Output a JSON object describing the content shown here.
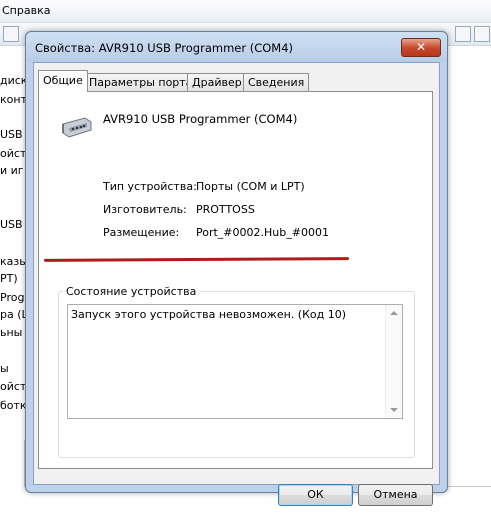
{
  "background_window": {
    "menu": {
      "help_label": "Справка"
    },
    "tree_fragments": [
      "диско",
      "контр",
      "USB",
      "ойств",
      "и иг",
      "USB",
      "казы",
      "PT)",
      "Prog",
      "ра (L",
      "ьны",
      "ы",
      "ойст",
      "ботк"
    ]
  },
  "dialog": {
    "title": "Свойства: AVR910 USB Programmer (COM4)",
    "close_glyph": "✕",
    "tabs": [
      {
        "label": "Общие",
        "active": true
      },
      {
        "label": "Параметры порта",
        "active": false
      },
      {
        "label": "Драйвер",
        "active": false
      },
      {
        "label": "Сведения",
        "active": false
      }
    ],
    "device_name": "AVR910 USB Programmer (COM4)",
    "properties": [
      {
        "label": "Тип устройства:",
        "value": "Порты (COM и LPT)"
      },
      {
        "label": "Изготовитель:",
        "value": "PROTTOSS"
      },
      {
        "label": "Размещение:",
        "value": "Port_#0002.Hub_#0001"
      }
    ],
    "status_group_label": "Состояние устройства",
    "status_text": "Запуск этого устройства невозможен. (Код 10)",
    "buttons": {
      "ok": "ОК",
      "cancel": "Отмена"
    }
  },
  "icons": {
    "device": "serial-port-connector-icon",
    "close": "close-icon"
  },
  "colors": {
    "annotation": "#b01a1a",
    "close_button": "#c4472a",
    "title_bar": "#bcd1ea"
  }
}
